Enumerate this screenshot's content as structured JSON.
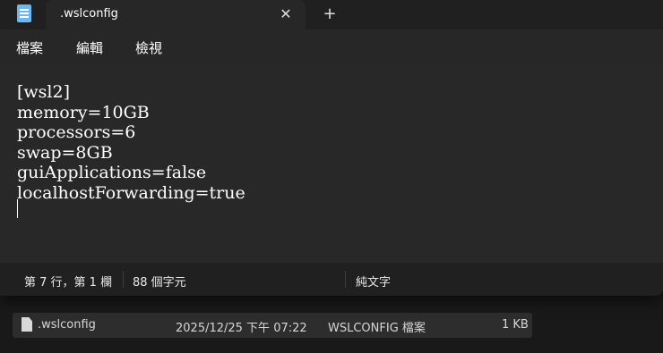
{
  "window": {
    "tab_title": ".wslconfig",
    "tab_close_glyph": "✕",
    "new_tab_glyph": "+"
  },
  "menu": {
    "items": [
      "檔案",
      "編輯",
      "檢視"
    ]
  },
  "editor": {
    "lines": [
      "[wsl2]",
      "memory=10GB",
      "processors=6",
      "swap=8GB",
      "guiApplications=false",
      "localhostForwarding=true"
    ]
  },
  "status": {
    "position": "第 7 行，第 1 欄",
    "char_count": "88 個字元",
    "format": "純文字"
  },
  "explorer": {
    "rows": [
      {
        "name": ".wslconfig",
        "date": "2025/12/25 下午 07:22",
        "type": "WSLCONFIG 檔案",
        "size": "1 KB"
      }
    ]
  },
  "colors": {
    "accent_icon": "#6cb8f0",
    "window_bg": "#272727",
    "titlebar_bg": "#202020"
  },
  "icons": {
    "app": "notepad-icon",
    "file": "file-icon"
  }
}
